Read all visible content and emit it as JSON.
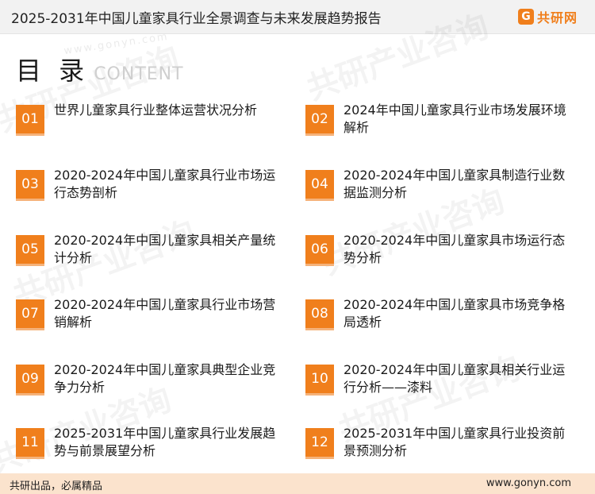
{
  "header": {
    "title": "2025-2031年中国儿童家具行业全景调查与未来发展趋势报告",
    "logo_mark": "G",
    "logo_text": "共研网",
    "logo_color": "#f07f1c"
  },
  "watermark": {
    "text": "共研产业咨询",
    "url": "www.gonyn.com"
  },
  "toc": {
    "title": "目 录",
    "subtitle": "CONTENT",
    "items": [
      {
        "num": "01",
        "label": "世界儿童家具行业整体运营状况分析"
      },
      {
        "num": "02",
        "label": "2024年中国儿童家具行业市场发展环境解析"
      },
      {
        "num": "03",
        "label": "2020-2024年中国儿童家具行业市场运行态势剖析"
      },
      {
        "num": "04",
        "label": "2020-2024年中国儿童家具制造行业数据监测分析"
      },
      {
        "num": "05",
        "label": "2020-2024年中国儿童家具相关产量统计分析"
      },
      {
        "num": "06",
        "label": "2020-2024年中国儿童家具市场运行态势分析"
      },
      {
        "num": "07",
        "label": "2020-2024年中国儿童家具行业市场营销解析"
      },
      {
        "num": "08",
        "label": "2020-2024年中国儿童家具市场竞争格局透析"
      },
      {
        "num": "09",
        "label": "2020-2024年中国儿童家具典型企业竞争力分析"
      },
      {
        "num": "10",
        "label": "2020-2024年中国儿童家具相关行业运行分析——漆料"
      },
      {
        "num": "11",
        "label": "2025-2031年中国儿童家具行业发展趋势与前景展望分析"
      },
      {
        "num": "12",
        "label": "2025-2031年中国儿童家具行业投资前景预测分析"
      }
    ]
  },
  "footer": {
    "left": "共研出品，必属精品",
    "right": "www.gonyn.com"
  },
  "colors": {
    "accent": "#f07f1c",
    "footer_bg": "#fbe3cd"
  }
}
